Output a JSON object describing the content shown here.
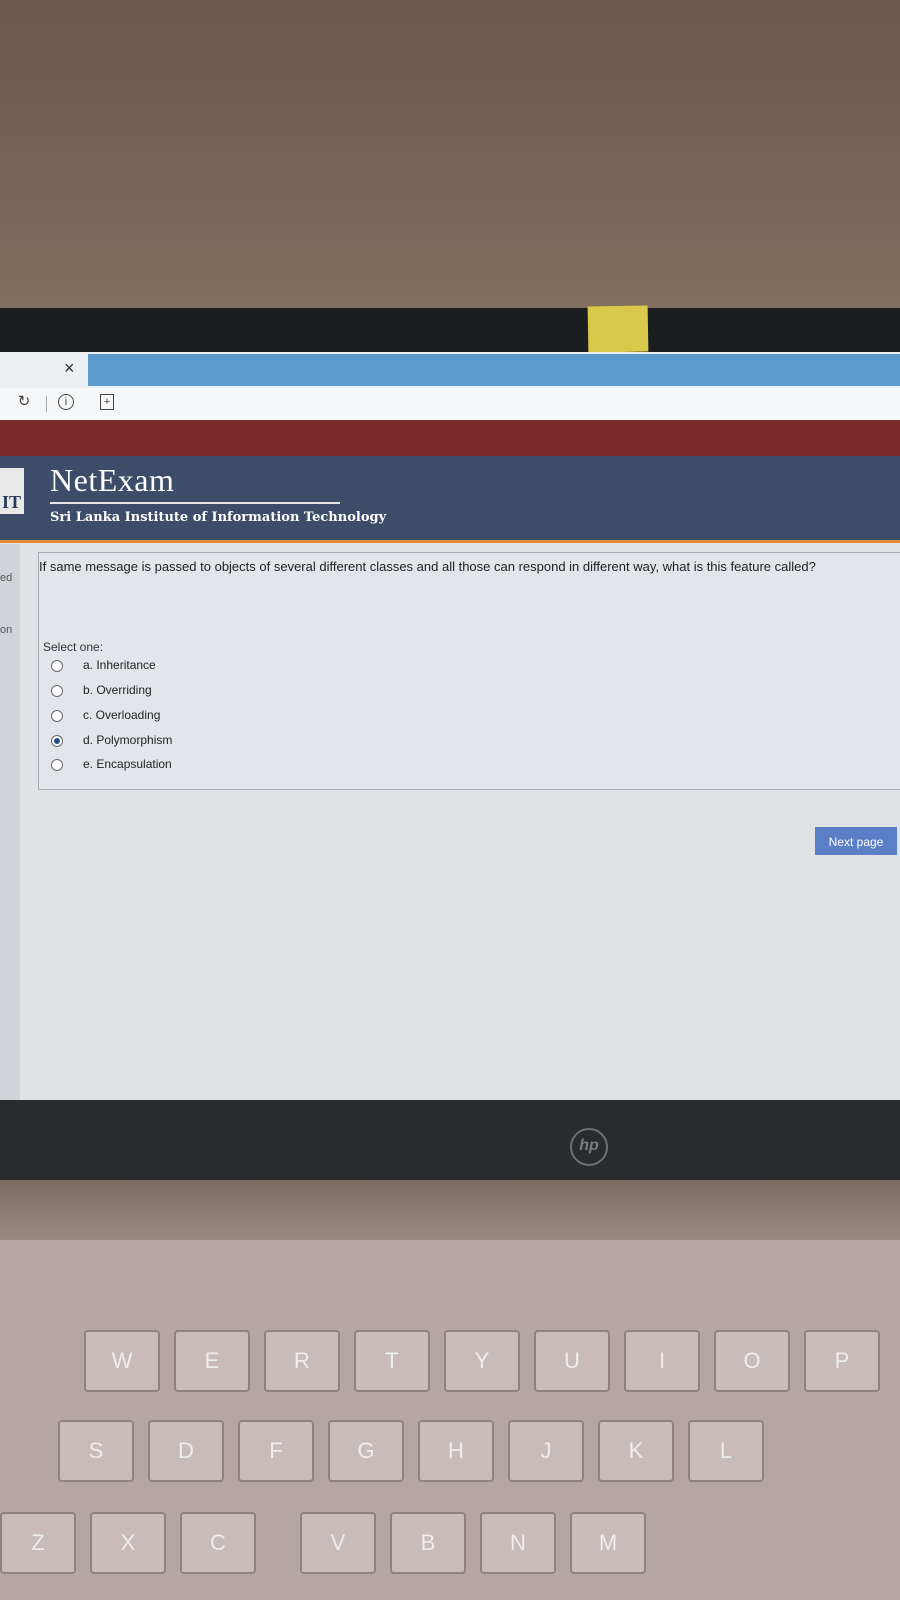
{
  "browser": {
    "tab_close": "×",
    "icons": [
      "reload-icon",
      "info-icon",
      "page-icon"
    ]
  },
  "header": {
    "brand": "NetExam",
    "institution": "Sri Lanka Institute of Information Technology",
    "logo_text": "IT"
  },
  "side": {
    "top_fragment": "ed",
    "bottom_fragment": "on"
  },
  "question": {
    "text": "If same message is passed to objects of several different classes and all those can respond in different way, what is this feature called?",
    "select_label": "Select one:",
    "options": [
      {
        "label": "a. Inheritance",
        "selected": false
      },
      {
        "label": "b. Overriding",
        "selected": false
      },
      {
        "label": "c. Overloading",
        "selected": false
      },
      {
        "label": "d. Polymorphism",
        "selected": true
      },
      {
        "label": "e. Encapsulation",
        "selected": false
      }
    ]
  },
  "nav": {
    "next_label": "Next page"
  },
  "device": {
    "brand_logo": "hp",
    "keys_row1": [
      "W",
      "E",
      "R",
      "T",
      "Y",
      "U",
      "I",
      "O",
      "P"
    ],
    "keys_row2": [
      "S",
      "D",
      "F",
      "G",
      "H",
      "J",
      "K",
      "L"
    ],
    "keys_row3": [
      "Z",
      "X",
      "C",
      "V",
      "B",
      "N",
      "M"
    ]
  },
  "colors": {
    "header_bg": "#3d4d69",
    "red_bar": "#7b2a2a",
    "accent_orange": "#e28a35",
    "button_blue": "#5b7fc6"
  }
}
